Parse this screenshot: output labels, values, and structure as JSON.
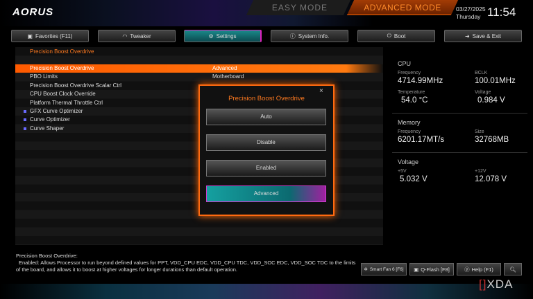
{
  "header": {
    "logo": "AORUS",
    "easy_mode": "EASY MODE",
    "advanced_mode": "ADVANCED MODE",
    "date": "03/27/2025",
    "day": "Thursday",
    "time": "11:54"
  },
  "nav": [
    {
      "label": "Favorites (F11)",
      "icon": "star-icon"
    },
    {
      "label": "Tweaker",
      "icon": "gauge-icon"
    },
    {
      "label": "Settings",
      "icon": "gear-icon"
    },
    {
      "label": "System Info.",
      "icon": "info-icon"
    },
    {
      "label": "Boot",
      "icon": "power-icon"
    },
    {
      "label": "Save & Exit",
      "icon": "exit-icon"
    }
  ],
  "breadcrumb": "Precision Boost Overdrive",
  "settings": [
    {
      "label": "Precision Boost Overdrive",
      "value": "Advanced"
    },
    {
      "label": "PBO Limits",
      "value": "Motherboard"
    },
    {
      "label": "Precision Boost Overdrive Scalar Ctrl",
      "value": ""
    },
    {
      "label": "CPU Boost Clock Override",
      "value": ""
    },
    {
      "label": "Platform Thermal Throttle Ctrl",
      "value": ""
    },
    {
      "label": "GFX Curve Optimizer",
      "value": ""
    },
    {
      "label": "Curve Optimizer",
      "value": ""
    },
    {
      "label": "Curve Shaper",
      "value": ""
    }
  ],
  "popup": {
    "title": "Precision Boost Overdrive",
    "close": "×",
    "options": [
      "Auto",
      "Disable",
      "Enabled",
      "Advanced"
    ],
    "selected": "Advanced"
  },
  "side": {
    "cpu": {
      "title": "CPU",
      "freq_label": "Frequency",
      "freq": "4714.99MHz",
      "bclk_label": "BCLK",
      "bclk": "100.01MHz",
      "temp_label": "Temperature",
      "temp": "54.0 °C",
      "volt_label": "Voltage",
      "volt": "0.984 V"
    },
    "memory": {
      "title": "Memory",
      "freq_label": "Frequency",
      "freq": "6201.17MT/s",
      "size_label": "Size",
      "size": "32768MB"
    },
    "voltage": {
      "title": "Voltage",
      "p5_label": "+5V",
      "p5": "5.032 V",
      "p12_label": "+12V",
      "p12": "12.078 V"
    }
  },
  "help": {
    "title": "Precision Boost Overdrive:",
    "line1": "Enabled: Allows Processor to run beyond defined values for PPT, VDD_CPU EDC, VDD_CPU TDC, VDD_SOC EDC, VDD_SOC TDC to the limits",
    "line2": "of the board, and allows it to boost at higher voltages for longer durations than default operation."
  },
  "bottom": {
    "smartfan": "Smart Fan 6 [F6]",
    "qflash": "Q-Flash [F8]",
    "help": "Help (F1)",
    "watermark": "XDA"
  }
}
